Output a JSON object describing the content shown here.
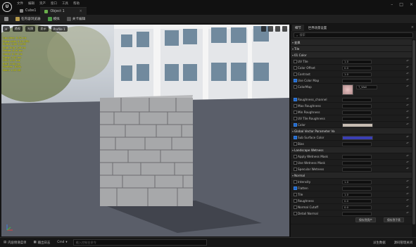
{
  "menu": [
    "文件",
    "编辑",
    "资产",
    "窗口",
    "工具",
    "帮助"
  ],
  "tabs": [
    {
      "label": "Cube1",
      "active": false
    },
    {
      "label": "Object 1",
      "active": true
    }
  ],
  "toolbar": {
    "save": "",
    "content_browser": "在内容浏览器",
    "play": "模拟",
    "settings": "关卡编辑"
  },
  "viewport": {
    "perspective_btn": "透视",
    "lit_btn": "光照",
    "show_btn": "显示",
    "profile_btn": "Profile 1",
    "stats": [
      "Gpu time: 6.32 ms",
      "Draw calls: 0.19 GPU",
      "Prims: 0.00 5.97M",
      "Stat: Unit 1.06 ms",
      "Frame: 8.16 ms",
      "Game: 0.34 ms",
      "Draw: 0.42 ms",
      "GPU: 5.97 ms",
      "RHIT: 0.00 ms",
      "DynRes: 100%",
      "Mem: 1.55 GB"
    ]
  },
  "details": {
    "tab_details": "细节",
    "tab_world": "世界场景设置",
    "search_placeholder": "搜索",
    "sections": [
      {
        "kind": "section",
        "label": "变换"
      },
      {
        "kind": "section",
        "label": "Tile"
      },
      {
        "kind": "section",
        "label": "01 Color"
      },
      {
        "kind": "row",
        "label": "UV Tile",
        "value": "1.0",
        "checkbox": false
      },
      {
        "kind": "row",
        "label": "Color Offset",
        "value": "0.0",
        "checkbox": false
      },
      {
        "kind": "row",
        "label": "Contrast",
        "value": "1.0",
        "checkbox": false
      },
      {
        "kind": "row",
        "label": "Use Color Map",
        "value": "",
        "checkbox": true
      },
      {
        "kind": "tex",
        "label": "ColorMap",
        "value": "T_Wall"
      },
      {
        "kind": "row",
        "label": "Roughness_channel",
        "value": "",
        "checkbox": true
      },
      {
        "kind": "row",
        "label": "Max Roughness",
        "value": "",
        "checkbox": false
      },
      {
        "kind": "row",
        "label": "Min Roughness",
        "value": "",
        "checkbox": false
      },
      {
        "kind": "row",
        "label": "UV Tile Roughness",
        "value": "",
        "checkbox": false
      },
      {
        "kind": "color",
        "label": "Color",
        "value": "",
        "checkbox": true,
        "color": "#c7bdb3"
      },
      {
        "kind": "section",
        "label": "Global Vector Parameter Va"
      },
      {
        "kind": "color",
        "label": "Sub Surface Color",
        "value": "",
        "checkbox": true,
        "color": "#3b3fb5"
      },
      {
        "kind": "row",
        "label": "Bias",
        "value": "",
        "checkbox": false
      },
      {
        "kind": "section",
        "label": "Landscape Wetness"
      },
      {
        "kind": "row",
        "label": "Apply Wetness Mask",
        "value": "",
        "checkbox": false
      },
      {
        "kind": "row",
        "label": "Use Wetness Mask",
        "value": "",
        "checkbox": false
      },
      {
        "kind": "row",
        "label": "Specular Wetness",
        "value": "",
        "checkbox": false
      },
      {
        "kind": "section",
        "label": "Normal"
      },
      {
        "kind": "row",
        "label": "Intensity",
        "value": "1.0",
        "checkbox": false
      },
      {
        "kind": "row",
        "label": "Flatten",
        "value": "",
        "checkbox": true
      },
      {
        "kind": "row",
        "label": "Tile",
        "value": "1.0",
        "checkbox": false
      },
      {
        "kind": "row",
        "label": "Roughness",
        "value": "0.0",
        "checkbox": false
      },
      {
        "kind": "row",
        "label": "Normal Cutoff",
        "value": "0.0",
        "checkbox": false
      },
      {
        "kind": "row",
        "label": "Detail Normal",
        "value": "",
        "checkbox": false
      }
    ],
    "button_save": "保存到资产",
    "button_more": "保存到子类"
  },
  "bottombar": {
    "content_drawer": "内容侧滑菜单",
    "output_log": "输出日志",
    "cmd": "Cmd",
    "console_placeholder": "输入控制台命令",
    "derived_data": "派生数据",
    "source_control": "源码管理关闭"
  }
}
